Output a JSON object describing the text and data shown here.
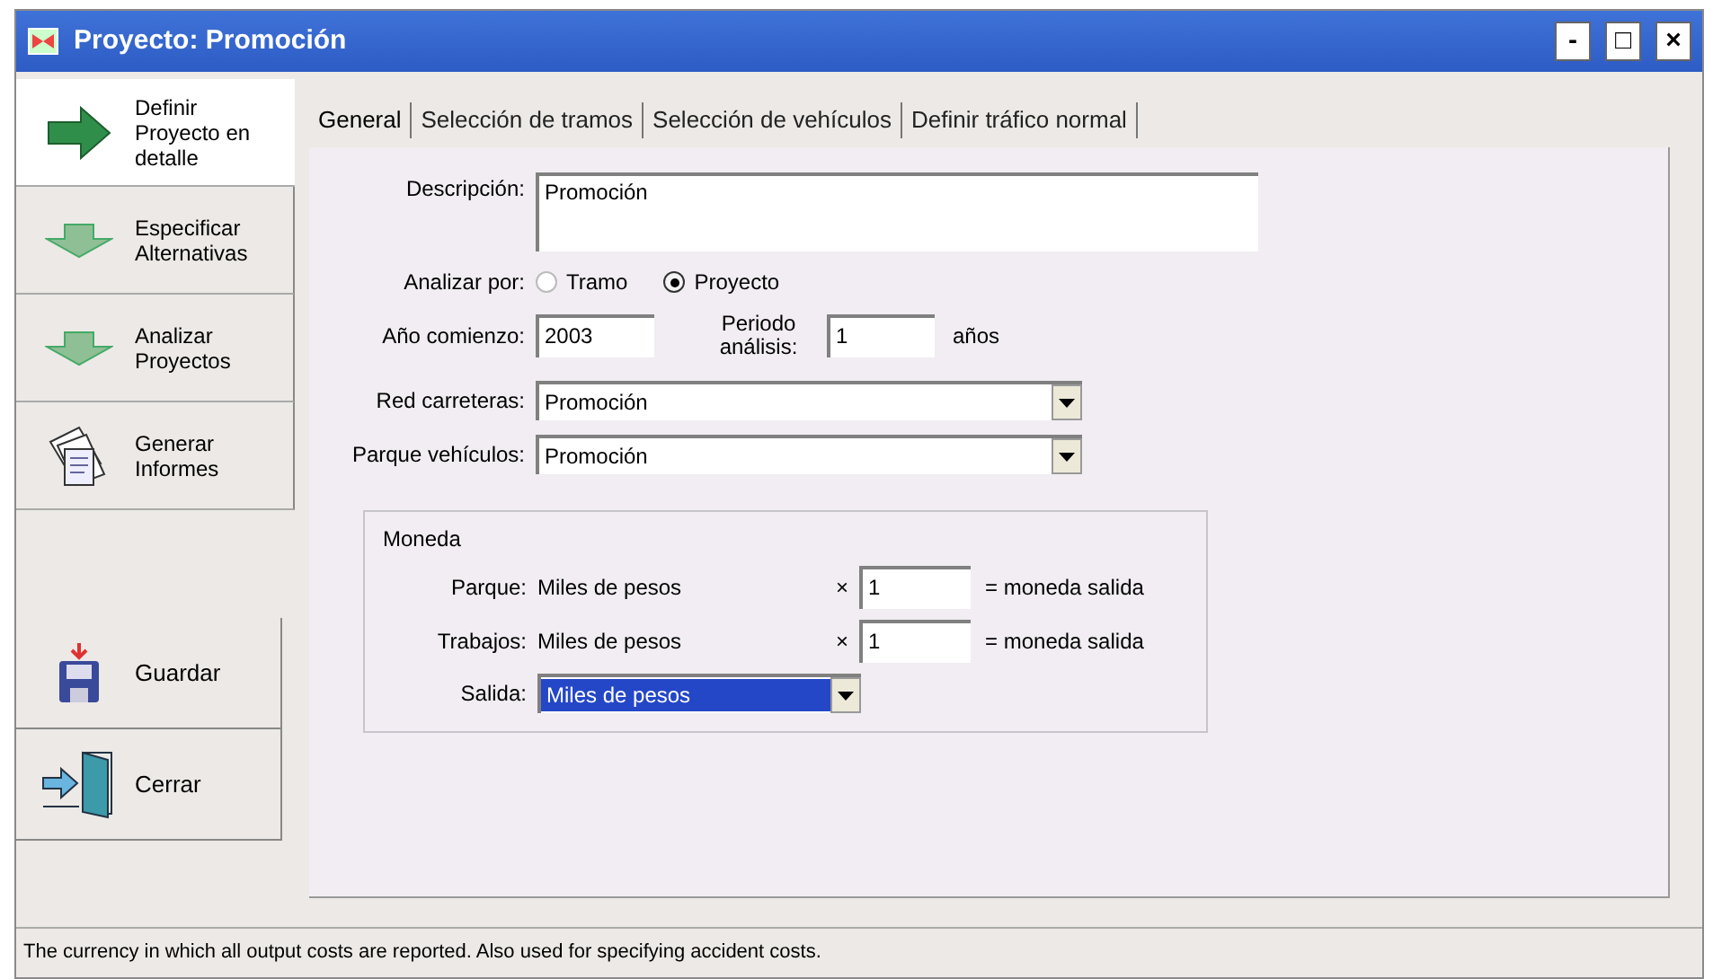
{
  "window": {
    "title": "Proyecto: Promoción",
    "controls": [
      "-",
      "□",
      "×"
    ]
  },
  "sidebar": {
    "items": [
      {
        "kind": "step",
        "label": "Definir Proyecto en detalle",
        "selected": true
      },
      {
        "kind": "step",
        "label": "Especificar Alternativas",
        "selected": false
      },
      {
        "kind": "step",
        "label": "Analizar Proyectos",
        "selected": false
      },
      {
        "kind": "step",
        "label": "Generar Informes",
        "selected": false
      },
      {
        "kind": "action",
        "label": "Guardar"
      },
      {
        "kind": "action",
        "label": "Cerrar"
      }
    ]
  },
  "tabs": [
    {
      "label": "General",
      "selected": true
    },
    {
      "label": "Selección de tramos",
      "selected": false
    },
    {
      "label": "Selección de vehículos",
      "selected": false
    },
    {
      "label": "Definir tráfico normal",
      "selected": false
    }
  ],
  "form": {
    "descripcion": {
      "label": "Descripción:",
      "value": "Promoción"
    },
    "analizar_por": {
      "label": "Analizar por:",
      "options": [
        {
          "label": "Tramo",
          "selected": false
        },
        {
          "label": "Proyecto",
          "selected": true
        }
      ]
    },
    "ano_comienzo": {
      "label": "Año comienzo:",
      "value": "2003"
    },
    "periodo": {
      "label": "Periodo análisis:",
      "value": "1",
      "unit": "años"
    },
    "red_carreteras": {
      "label": "Red carreteras:",
      "value": "Promoción"
    },
    "parque_vehiculos": {
      "label": "Parque vehículos:",
      "value": "Promoción"
    },
    "moneda": {
      "title": "Moneda",
      "rows": [
        {
          "label": "Parque:",
          "currency": "Miles de pesos",
          "times": "×",
          "factor": "1",
          "result": "= moneda salida"
        },
        {
          "label": "Trabajos:",
          "currency": "Miles de pesos",
          "times": "×",
          "factor": "1",
          "result": "= moneda salida"
        }
      ],
      "salida": {
        "label": "Salida:",
        "value": "Miles de pesos"
      }
    }
  },
  "status_bar": "The currency in which all output costs are reported. Also used for specifying accident costs."
}
